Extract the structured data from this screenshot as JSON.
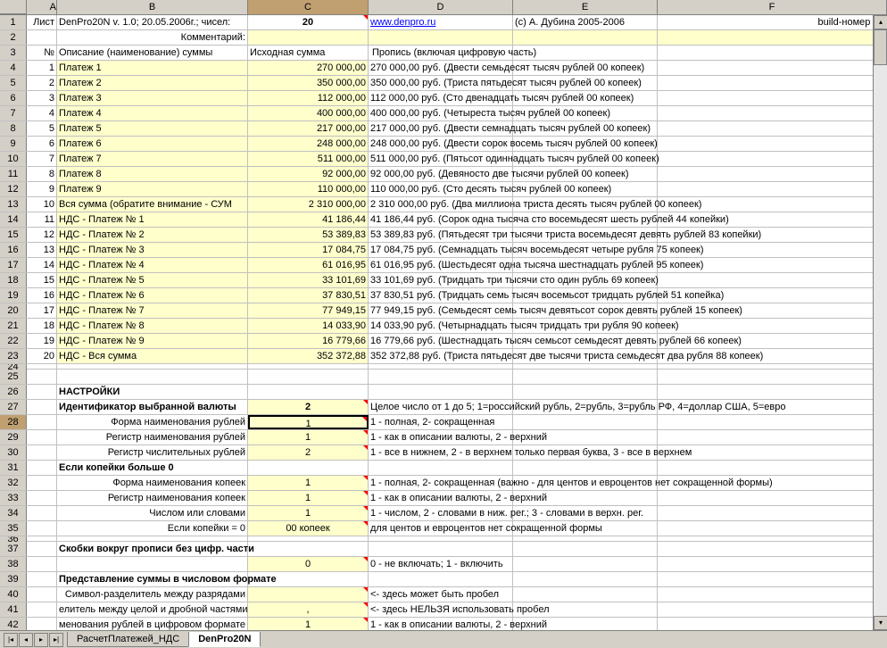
{
  "cols": [
    "A",
    "B",
    "C",
    "D",
    "E",
    "F"
  ],
  "header_row": {
    "A": "Лист",
    "B": "DenPro20N v. 1.0; 20.05.2006г.; чисел:",
    "C": "20",
    "D": "www.denpro.ru",
    "E": "(c) А. Дубина 2005-2006",
    "F": "build-номер ли"
  },
  "comment_label": "Комментарий:",
  "table_header": {
    "A": "№",
    "B": "Описание (наименование) суммы",
    "C": "Исходная сумма",
    "DEF": "Пропись (включая цифровую часть)"
  },
  "rows": [
    {
      "n": "1",
      "b": "Платеж 1",
      "c": "270 000,00",
      "d": "270 000,00 руб. (Двести семьдесят тысяч рублей 00 копеек)"
    },
    {
      "n": "2",
      "b": "Платеж 2",
      "c": "350 000,00",
      "d": "350 000,00 руб. (Триста пятьдесят тысяч рублей 00 копеек)"
    },
    {
      "n": "3",
      "b": "Платеж 3",
      "c": "112 000,00",
      "d": "112 000,00 руб. (Сто двенадцать тысяч рублей 00 копеек)"
    },
    {
      "n": "4",
      "b": "Платеж 4",
      "c": "400 000,00",
      "d": "400 000,00 руб. (Четыреста тысяч рублей 00 копеек)"
    },
    {
      "n": "5",
      "b": "Платеж 5",
      "c": "217 000,00",
      "d": "217 000,00 руб. (Двести семнадцать тысяч рублей 00 копеек)"
    },
    {
      "n": "6",
      "b": "Платеж 6",
      "c": "248 000,00",
      "d": "248 000,00 руб. (Двести сорок восемь тысяч рублей 00 копеек)"
    },
    {
      "n": "7",
      "b": "Платеж 7",
      "c": "511 000,00",
      "d": "511 000,00 руб. (Пятьсот одиннадцать тысяч рублей 00 копеек)"
    },
    {
      "n": "8",
      "b": "Платеж 8",
      "c": "92 000,00",
      "d": "92 000,00 руб. (Девяносто две тысячи рублей 00 копеек)"
    },
    {
      "n": "9",
      "b": "Платеж 9",
      "c": "110 000,00",
      "d": "110 000,00 руб. (Сто десять тысяч рублей 00 копеек)"
    },
    {
      "n": "10",
      "b": "Вся сумма (обратите внимание - СУМ",
      "c": "2 310 000,00",
      "d": "2 310 000,00 руб. (Два миллиона триста десять тысяч рублей 00 копеек)"
    },
    {
      "n": "11",
      "b": "НДС - Платеж № 1",
      "c": "41 186,44",
      "d": "41 186,44 руб. (Сорок одна тысяча сто восемьдесят шесть рублей 44 копейки)"
    },
    {
      "n": "12",
      "b": "НДС - Платеж № 2",
      "c": "53 389,83",
      "d": "53 389,83 руб. (Пятьдесят три тысячи триста восемьдесят девять рублей 83 копейки)"
    },
    {
      "n": "13",
      "b": "НДС - Платеж № 3",
      "c": "17 084,75",
      "d": "17 084,75 руб. (Семнадцать тысяч восемьдесят четыре рубля 75 копеек)"
    },
    {
      "n": "14",
      "b": "НДС - Платеж № 4",
      "c": "61 016,95",
      "d": "61 016,95 руб. (Шестьдесят одна тысяча шестнадцать рублей 95 копеек)"
    },
    {
      "n": "15",
      "b": "НДС - Платеж № 5",
      "c": "33 101,69",
      "d": "33 101,69 руб. (Тридцать три тысячи сто один рубль 69 копеек)"
    },
    {
      "n": "16",
      "b": "НДС - Платеж № 6",
      "c": "37 830,51",
      "d": "37 830,51 руб. (Тридцать семь тысяч восемьсот тридцать рублей 51 копейка)"
    },
    {
      "n": "17",
      "b": "НДС - Платеж № 7",
      "c": "77 949,15",
      "d": "77 949,15 руб. (Семьдесят семь тысяч девятьсот сорок девять рублей 15 копеек)"
    },
    {
      "n": "18",
      "b": "НДС - Платеж № 8",
      "c": "14 033,90",
      "d": "14 033,90 руб. (Четырнадцать тысяч тридцать три рубля 90 копеек)"
    },
    {
      "n": "19",
      "b": "НДС - Платеж № 9",
      "c": "16 779,66",
      "d": "16 779,66 руб. (Шестнадцать тысяч семьсот семьдесят девять рублей 66 копеек)"
    },
    {
      "n": "20",
      "b": "НДС - Вся сумма",
      "c": "352 372,88",
      "d": "352 372,88 руб. (Триста пятьдесят две тысячи триста семьдесят два рубля 88 копеек)"
    }
  ],
  "settings_title": "НАСТРОЙКИ",
  "currency_id_label": "Идентификатор выбранной валюты",
  "currency_id_value": "2",
  "currency_id_hint": "Целое число от 1 до 5; 1=российский рубль, 2=рубль, 3=рубль РФ, 4=доллар США, 5=евро",
  "settings": [
    {
      "b": "Форма наименования рублей",
      "c": "1",
      "d": "1 - полная, 2- сокращенная",
      "active": true
    },
    {
      "b": "Регистр наименования рублей",
      "c": "1",
      "d": "1 - как в описании валюты, 2 - верхний"
    },
    {
      "b": "Регистр числительных рублей",
      "c": "2",
      "d": "1 - все в нижнем, 2 - в верхнем только первая буква, 3 - все в верхнем"
    }
  ],
  "kopeck_title": "Если копейки больше 0",
  "kopeck_settings": [
    {
      "b": "Форма наименования копеек",
      "c": "1",
      "d": "1 - полная, 2- сокращенная (важно - для центов и евроцентов нет сокращенной формы)"
    },
    {
      "b": "Регистр наименования копеек",
      "c": "1",
      "d": "1 - как в описании валюты, 2 - верхний"
    },
    {
      "b": "Числом или словами",
      "c": "1",
      "d": "1 - числом, 2 - словами в ниж. рег.; 3 - словами в верхн. рег."
    }
  ],
  "zero_kopeck": {
    "b": "Если копейки = 0",
    "c": "00 копеек",
    "d": "для центов и евроцентов нет сокращенной формы"
  },
  "brackets_title": "Скобки вокруг прописи без цифр. части",
  "brackets": {
    "c": "0",
    "d": "0 - не включать; 1 - включить"
  },
  "numformat_title": "Представление суммы в числовом формате",
  "numformat_rows": [
    {
      "b": "Символ-разделитель между разрядами",
      "c": "",
      "d": "<- здесь может быть пробел"
    },
    {
      "b": "елитель между целой и дробной частями",
      "c": ",",
      "d": "<- здесь НЕЛЬЗЯ использовать пробел"
    },
    {
      "b": "менования рублей в цифровом формате",
      "c": "1",
      "d": "1 - как в описании валюты, 2 - верхний"
    }
  ],
  "tabs": [
    {
      "label": "РасчетПлатежей_НДС",
      "active": false
    },
    {
      "label": "DenPro20N",
      "active": true
    }
  ]
}
